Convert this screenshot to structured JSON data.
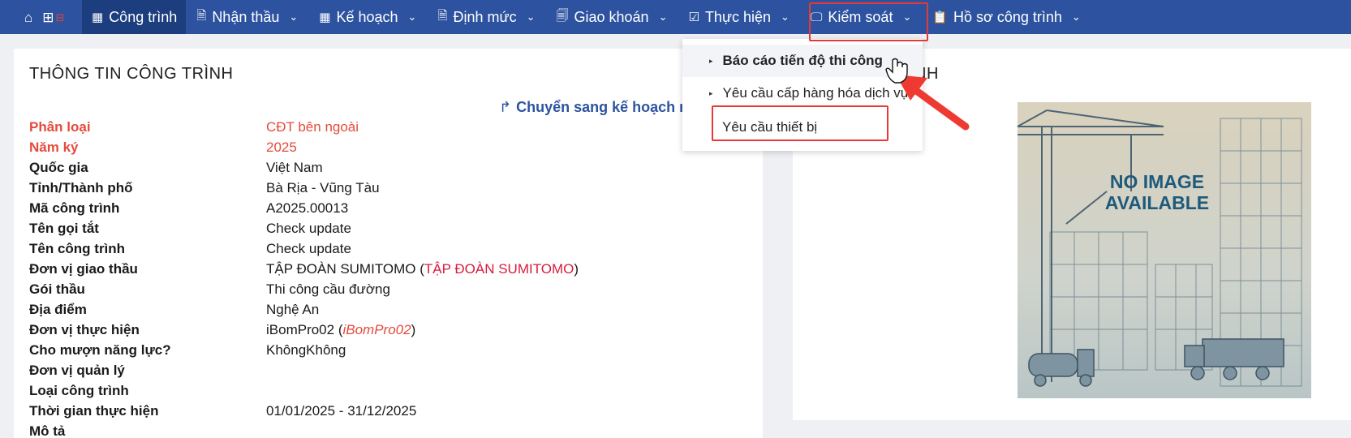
{
  "nav": {
    "home_icon": "home-icon",
    "grid_icon": "grid-plus-icon",
    "extra_icon": "split-icon",
    "items": [
      {
        "label": "Công trình",
        "icon": "table-icon",
        "active": true
      },
      {
        "label": "Nhận thầu",
        "icon": "document-icon"
      },
      {
        "label": "Kế hoạch",
        "icon": "grid-icon"
      },
      {
        "label": "Định mức",
        "icon": "document-icon"
      },
      {
        "label": "Giao khoán",
        "icon": "documents-icon"
      },
      {
        "label": "Thực hiện",
        "icon": "checkbox-icon"
      },
      {
        "label": "Kiểm soát",
        "icon": "monitor-icon"
      },
      {
        "label": "Hồ sơ công trình",
        "icon": "clipboard-check-icon"
      }
    ]
  },
  "dropdown": {
    "items": [
      {
        "label": "Báo cáo tiến độ thi công"
      },
      {
        "label": "Yêu cầu cấp hàng hóa dịch vụ"
      },
      {
        "label": "Yêu cầu thiết bị"
      }
    ]
  },
  "left": {
    "title": "THÔNG TIN CÔNG TRÌNH",
    "switch_link": "Chuyển sang kế hoạch n",
    "rows": [
      {
        "label": "Phân loại",
        "value": "CĐT bên ngoài"
      },
      {
        "label": "Năm ký",
        "value": "2025"
      },
      {
        "label": "Quốc gia",
        "value": "Việt Nam"
      },
      {
        "label": "Tỉnh/Thành phố",
        "value": "Bà Rịa - Vũng Tàu"
      },
      {
        "label": "Mã công trình",
        "value": "A2025.00013"
      },
      {
        "label": "Tên gọi tắt",
        "value": "Check update"
      },
      {
        "label": "Tên công trình",
        "value": "Check update"
      },
      {
        "label": "Đơn vị giao thầu",
        "value": "TẬP ĐOÀN SUMITOMO (",
        "value_ext": "TẬP ĐOÀN SUMITOMO",
        "value_tail": ")"
      },
      {
        "label": "Gói thầu",
        "value": "Thi công cầu đường"
      },
      {
        "label": "Địa điểm",
        "value": "Nghệ An"
      },
      {
        "label": "Đơn vị thực hiện",
        "value": "iBomPro02 (",
        "value_ext": "iBomPro02",
        "value_tail": ")"
      },
      {
        "label": "Cho mượn năng lực?",
        "value": "KhôngKhông"
      },
      {
        "label": "Đơn vị quản lý",
        "value": ""
      },
      {
        "label": "Loại công trình",
        "value": ""
      },
      {
        "label": "Thời gian thực hiện",
        "value": "01/01/2025 - 31/12/2025"
      },
      {
        "label": "Mô tả",
        "value": ""
      }
    ]
  },
  "right": {
    "title_partial": "NH",
    "noimage_line1": "NO IMAGE",
    "noimage_line2": "AVAILABLE"
  },
  "colors": {
    "nav_bg": "#2d53a0",
    "nav_active": "#1c3e7f",
    "accent_red": "#e53935",
    "label_red": "#e44b3c",
    "link_blue": "#2d53a0"
  }
}
